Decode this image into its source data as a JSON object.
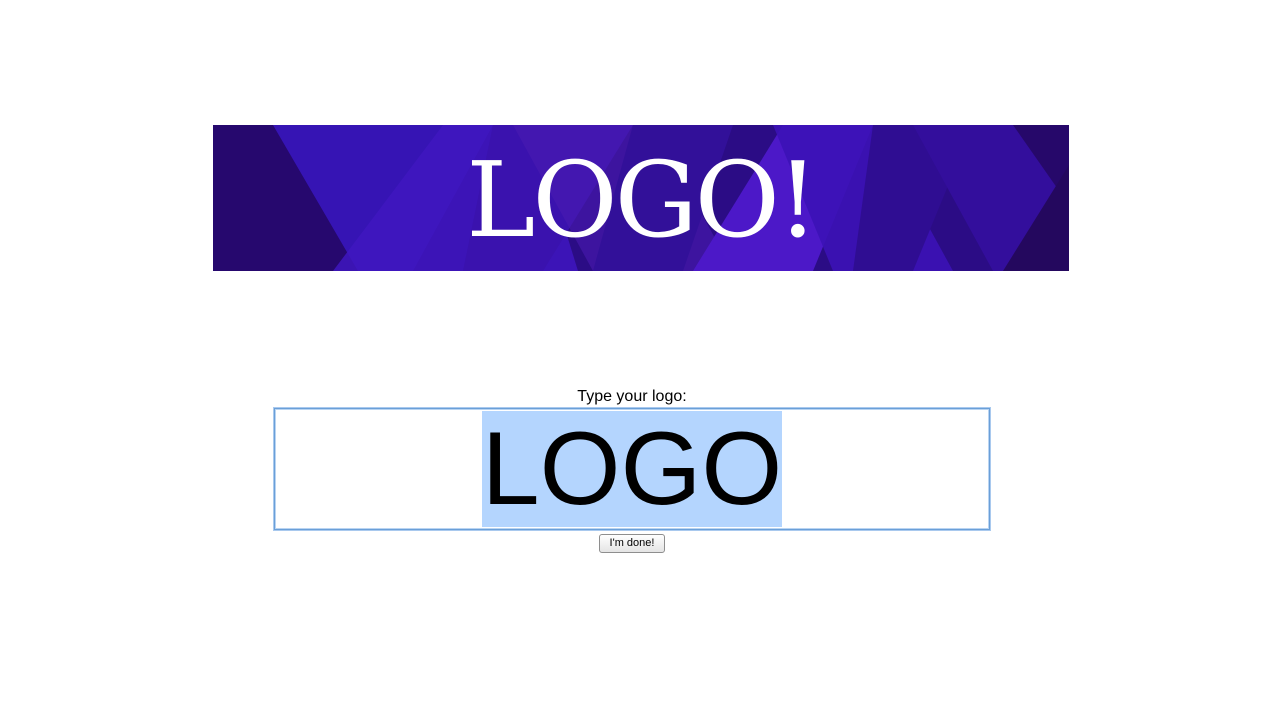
{
  "banner": {
    "logo_text": "LOGO!",
    "background_color": "#2e0f8a",
    "accent_colors": [
      "#3a13b0",
      "#4a16c8",
      "#24095f",
      "#5a1ad6"
    ]
  },
  "form": {
    "prompt_label": "Type your logo:",
    "logo_input_value": "LOGO",
    "selection_color": "#b4d5fe",
    "focus_border_color": "#6a9fd8",
    "done_button_label": "I'm done!"
  }
}
